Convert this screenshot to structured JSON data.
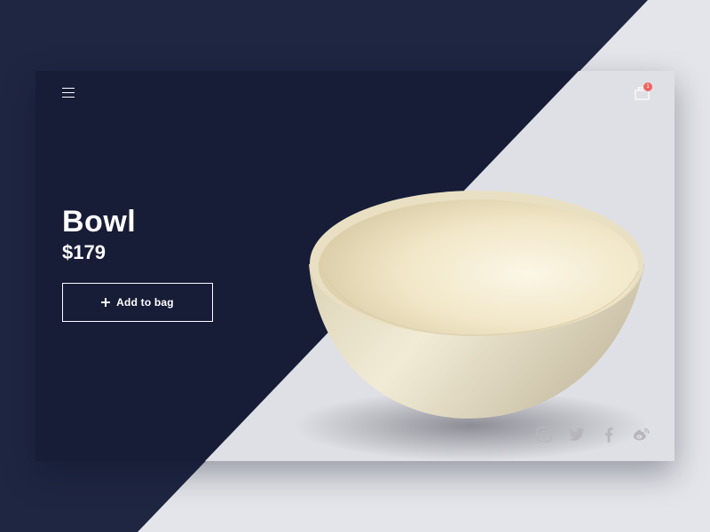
{
  "product": {
    "name": "Bowl",
    "price": "$179",
    "add_label": "Add to bag"
  },
  "cart": {
    "count": "1"
  },
  "social": [
    "instagram-icon",
    "twitter-icon",
    "facebook-icon",
    "weibo-icon"
  ],
  "colors": {
    "navy_outer": "#1f2642",
    "navy_card": "#171c37",
    "light_bg": "#e4e5ea",
    "badge": "#f06363",
    "bowl": "#ece2c5"
  }
}
